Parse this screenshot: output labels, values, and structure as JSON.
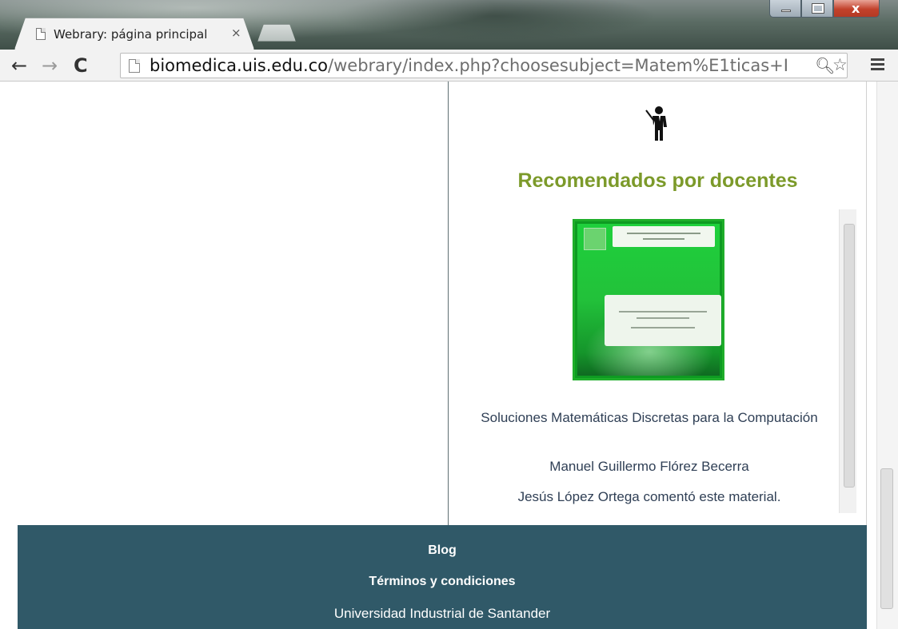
{
  "browser": {
    "tab_title": "Webrary: página principal",
    "tab_close": "×",
    "url_host": "biomedica.uis.edu.co",
    "url_path": "/webrary/index.php?choosesubject=Matem%E1ticas+I",
    "icons": {
      "back": "back-arrow-icon",
      "forward": "forward-arrow-icon",
      "reload": "reload-icon",
      "search": "search-icon",
      "bookmark": "star-icon",
      "menu": "hamburger-menu-icon"
    }
  },
  "sidebar_right": {
    "icon": "teacher-icon",
    "heading": "Recomendados por docentes",
    "book": {
      "title": "Soluciones Matemáticas Discretas para la Computación",
      "author": "Manuel Guillermo Flórez Becerra",
      "comment": "Jesús López Ortega comentó este material."
    }
  },
  "footer": {
    "blog": "Blog",
    "terms": "Términos y condiciones",
    "university": "Universidad Industrial de Santander"
  },
  "colors": {
    "heading_green": "#7c9a2a",
    "footer_bg": "#305968",
    "book_cover_green": "#1fae2a",
    "text_blue": "#2f3f55"
  }
}
